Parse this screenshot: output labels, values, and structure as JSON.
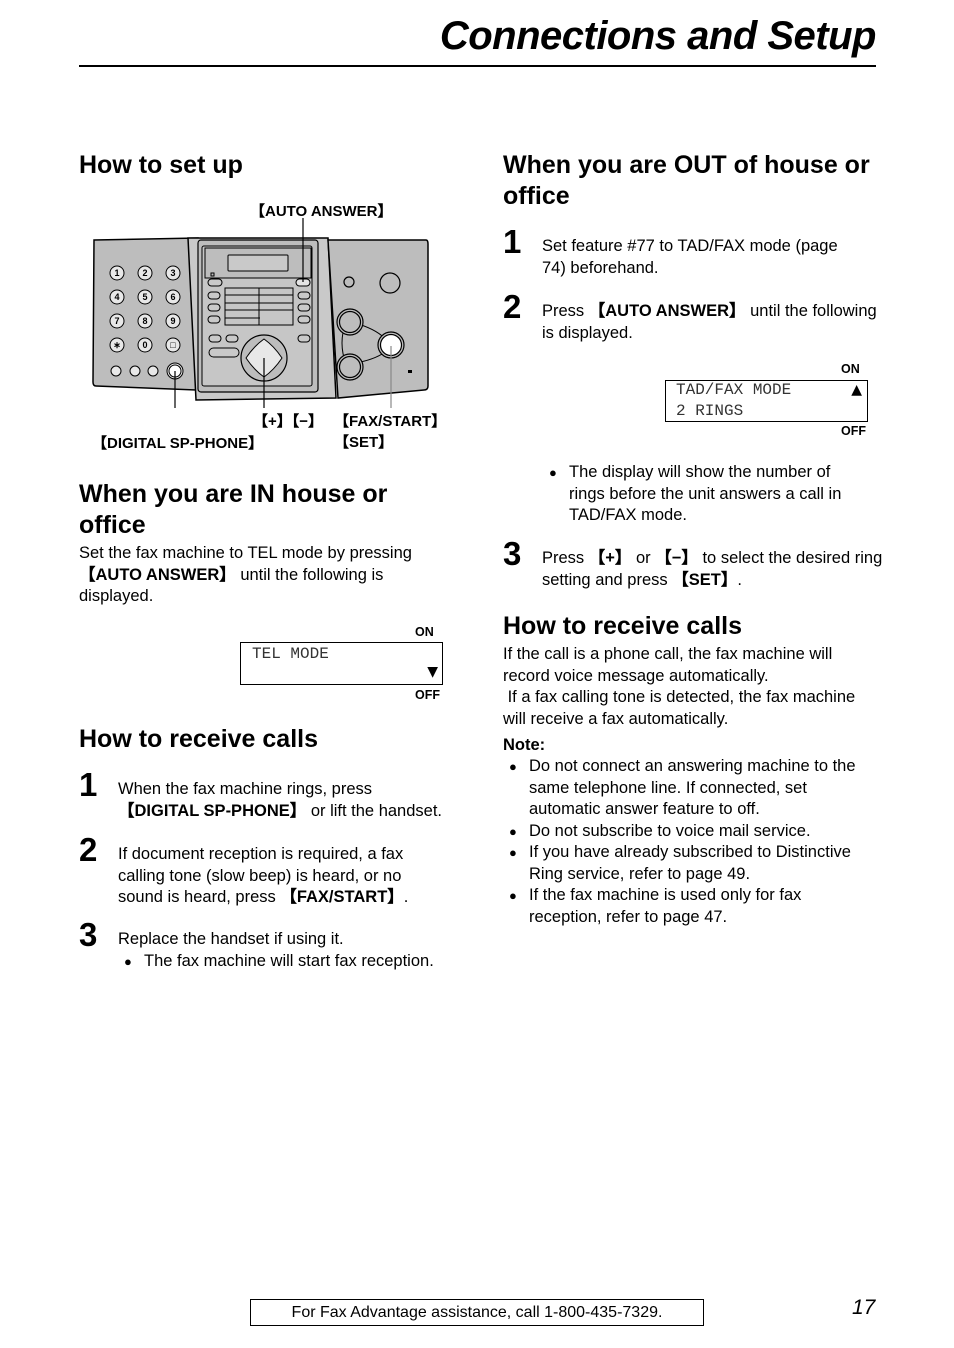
{
  "header": {
    "title": "Connections and Setup"
  },
  "left": {
    "setup": {
      "heading": "How to set up",
      "diagram": {
        "labels": {
          "auto_answer": "【AUTO ANSWER】",
          "plus_minus": "【+】【−】",
          "fax_start": "【FAX/START】",
          "set": "【SET】",
          "digital_sp_phone": "【DIGITAL SP-PHONE】"
        },
        "keypad": [
          "1",
          "2",
          "3",
          "4",
          "5",
          "6",
          "7",
          "8",
          "9",
          "∗",
          "0",
          "□"
        ]
      }
    },
    "in_house": {
      "heading_line1": "When you are IN house or",
      "heading_line2": "office",
      "text_1": "Set the fax machine to TEL mode by pressing",
      "key": "【AUTO ANSWER】",
      "text_2": " until the following is",
      "text_3": "displayed.",
      "display": {
        "on": "ON",
        "off": "OFF",
        "line1": "TEL MODE",
        "line2": "",
        "arrow": "▼"
      }
    },
    "receive": {
      "heading": "How to receive calls",
      "steps": [
        {
          "num": "1",
          "line1": "When the fax machine rings, press",
          "key": "【DIGITAL SP-PHONE】",
          "line2_rest": " or lift the handset."
        },
        {
          "num": "2",
          "line1": "If document reception is required, a fax",
          "line2": "calling tone (slow beep) is heard, or no",
          "line3_pre": "sound is heard, press ",
          "key": "【FAX/START】",
          "line3_post": "."
        },
        {
          "num": "3",
          "line1": "Replace the handset if using it.",
          "bullet": "The fax machine will start fax reception."
        }
      ]
    }
  },
  "right": {
    "out_house": {
      "heading_line1": "When you are OUT of house or",
      "heading_line2": "office",
      "steps": [
        {
          "num": "1",
          "line1": "Set feature #77 to TAD/FAX mode (page",
          "line2": "74) beforehand."
        },
        {
          "num": "2",
          "pre": "Press ",
          "key": "【AUTO ANSWER】",
          "post": " until the following",
          "line2": "is displayed."
        },
        {
          "num": "3",
          "pre": "Press ",
          "key_plus": "【+】",
          "mid": " or ",
          "key_minus": "【−】",
          "post": " to select the desired ring",
          "line2_pre": "setting and press ",
          "key_set": "【SET】",
          "line2_post": "."
        }
      ],
      "display": {
        "on": "ON",
        "off": "OFF",
        "line1": "TAD/FAX MODE",
        "line2": "2 RINGS",
        "arrow": "▲"
      },
      "bullet": [
        "The display will show the number of",
        "rings before the unit answers a call in",
        "TAD/FAX mode."
      ]
    },
    "receive": {
      "heading": "How to receive calls",
      "lines": [
        "If the call is a phone call, the fax machine will",
        "record voice message automatically.",
        " If a fax calling tone is detected, the fax machine",
        "will receive a fax automatically."
      ],
      "note_label": "Note:",
      "notes": [
        [
          "Do not connect an answering machine to the",
          "same telephone line. If connected, set",
          "automatic answer feature to off."
        ],
        [
          "Do not subscribe to voice mail service."
        ],
        [
          "If you have already subscribed to Distinctive",
          "Ring service, refer to page 49."
        ],
        [
          "If the fax machine is used only for fax",
          "reception, refer to page 47."
        ]
      ]
    }
  },
  "footer": {
    "assistance": "For Fax Advantage assistance, call 1-800-435-7329.",
    "page_number": "17"
  }
}
